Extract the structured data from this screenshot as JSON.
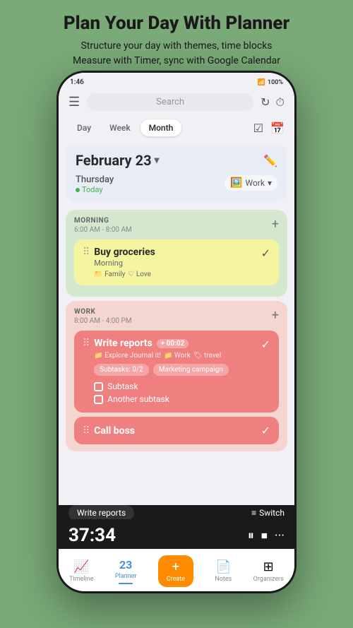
{
  "header": {
    "title": "Plan Your Day With Planner",
    "subtitle1": "Structure your day with themes, time blocks",
    "subtitle2": "Measure with Timer, sync with Google Calendar"
  },
  "statusBar": {
    "time": "1:46",
    "battery": "100%"
  },
  "topBar": {
    "searchPlaceholder": "Search",
    "hamburgerIcon": "☰",
    "refreshIcon": "↻",
    "timerIcon": "⏱"
  },
  "viewTabs": {
    "tabs": [
      "Day",
      "Week",
      "Month"
    ],
    "activeTab": "Day",
    "checkIcon": "✓",
    "calendarIcon": "📅"
  },
  "dateHeader": {
    "date": "February 23",
    "arrowIcon": "▾",
    "dayName": "Thursday",
    "today": "Today",
    "workLabel": "Work",
    "workEmoji": "🖼"
  },
  "morningSection": {
    "title": "MORNING",
    "timeRange": "6:00 AM - 8:00 AM",
    "task": {
      "name": "Buy groceries",
      "subtitle": "Morning",
      "tags": [
        "Family",
        "Love"
      ],
      "tagIcons": [
        "📁",
        "♡"
      ]
    }
  },
  "workSection": {
    "title": "WORK",
    "timeRange": "8:00 AM - 4:00 PM",
    "task": {
      "name": "Write reports",
      "subtitle": "Work",
      "timerLabel": "+ 00:02",
      "journalTag": "Explore Journal it!",
      "workTag": "Work",
      "travelTag": "travel",
      "subtasksBadge": "Subtasks: 0/2",
      "campaignBadge": "Marketing campaign",
      "subtasks": [
        "Subtask",
        "Another subtask"
      ]
    },
    "task2": {
      "name": "Call boss"
    }
  },
  "timerBar": {
    "time": "37:34",
    "pauseIcon": "⏸",
    "stopIcon": "⏹",
    "moreIcon": "···",
    "taskLabel": "Write reports",
    "switchLabel": "Switch",
    "switchIcon": "≡"
  },
  "bottomNav": {
    "items": [
      {
        "icon": "📈",
        "label": "Timeline",
        "active": false
      },
      {
        "icon": "23",
        "label": "Planner",
        "active": true
      },
      {
        "icon": "+",
        "label": "Create",
        "active": false,
        "special": true
      },
      {
        "icon": "📄",
        "label": "Notes",
        "active": false
      },
      {
        "icon": "⊞",
        "label": "Organizers",
        "active": false
      }
    ]
  }
}
